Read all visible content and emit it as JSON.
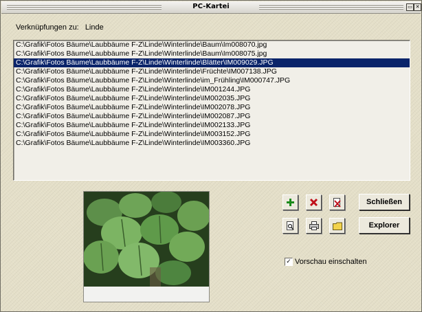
{
  "window": {
    "title": "PC-Kartei",
    "collapse_icon": "collapse-icon",
    "close_icon": "close-icon"
  },
  "links": {
    "label": "Verknüpfungen zu:",
    "value": "Linde"
  },
  "files": [
    {
      "path": "C:\\Grafik\\Fotos Bäume\\Laubbäume F-Z\\Linde\\Winterlinde\\Baum\\Im008070.jpg",
      "selected": false
    },
    {
      "path": "C:\\Grafik\\Fotos Bäume\\Laubbäume F-Z\\Linde\\Winterlinde\\Baum\\Im008075.jpg",
      "selected": false
    },
    {
      "path": "C:\\Grafik\\Fotos Bäume\\Laubbäume F-Z\\Linde\\Winterlinde\\Blätter\\IM009029.JPG",
      "selected": true
    },
    {
      "path": "C:\\Grafik\\Fotos Bäume\\Laubbäume F-Z\\Linde\\Winterlinde\\Früchte\\IM007138.JPG",
      "selected": false
    },
    {
      "path": "C:\\Grafik\\Fotos Bäume\\Laubbäume F-Z\\Linde\\Winterlinde\\im_Frühling\\IM000747.JPG",
      "selected": false
    },
    {
      "path": "C:\\Grafik\\Fotos Bäume\\Laubbäume F-Z\\Linde\\Winterlinde\\IM001244.JPG",
      "selected": false
    },
    {
      "path": "C:\\Grafik\\Fotos Bäume\\Laubbäume F-Z\\Linde\\Winterlinde\\IM002035.JPG",
      "selected": false
    },
    {
      "path": "C:\\Grafik\\Fotos Bäume\\Laubbäume F-Z\\Linde\\Winterlinde\\IM002078.JPG",
      "selected": false
    },
    {
      "path": "C:\\Grafik\\Fotos Bäume\\Laubbäume F-Z\\Linde\\Winterlinde\\IM002087.JPG",
      "selected": false
    },
    {
      "path": "C:\\Grafik\\Fotos Bäume\\Laubbäume F-Z\\Linde\\Winterlinde\\IM002133.JPG",
      "selected": false
    },
    {
      "path": "C:\\Grafik\\Fotos Bäume\\Laubbäume F-Z\\Linde\\Winterlinde\\IM003152.JPG",
      "selected": false
    },
    {
      "path": "C:\\Grafik\\Fotos Bäume\\Laubbäume F-Z\\Linde\\Winterlinde\\IM003360.JPG",
      "selected": false
    }
  ],
  "toolbar": {
    "add_icon": "add-icon",
    "delete_icon": "delete-icon",
    "remove_link_icon": "remove-link-icon",
    "preview_icon": "preview-icon",
    "print_icon": "print-icon",
    "folder_icon": "folder-icon"
  },
  "buttons": {
    "close_label": "Schließen",
    "explorer_label": "Explorer"
  },
  "preview_toggle": {
    "label": "Vorschau einschalten",
    "checked": true
  },
  "colors": {
    "selection": "#0a246a",
    "add_green": "#1a8a1a",
    "delete_red": "#c0101a"
  }
}
